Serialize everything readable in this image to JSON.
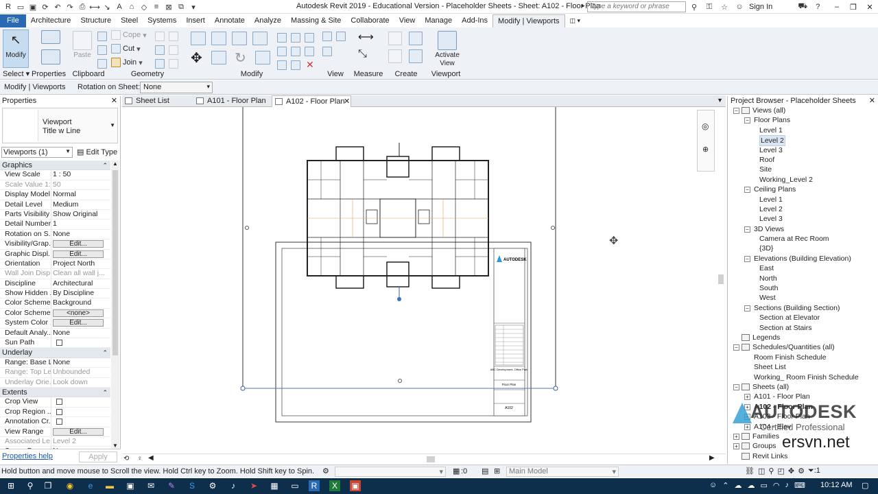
{
  "window": {
    "title": "Autodesk Revit 2019 - Educational Version - Placeholder Sheets - Sheet: A102 - Floor Plan",
    "search_placeholder": "Type a keyword or phrase",
    "sign_in": "Sign In"
  },
  "ribbon_tabs": [
    "File",
    "Architecture",
    "Structure",
    "Steel",
    "Systems",
    "Insert",
    "Annotate",
    "Analyze",
    "Massing & Site",
    "Collaborate",
    "View",
    "Manage",
    "Add-Ins",
    "Modify | Viewports"
  ],
  "ribbon": {
    "modify_label": "Modify",
    "select_label": "Select",
    "properties_label": "Properties",
    "clipboard_label": "Clipboard",
    "paste_label": "Paste",
    "cope_label": "Cope",
    "cut_label": "Cut",
    "join_label": "Join",
    "geometry_label": "Geometry",
    "modify_panel_label": "Modify",
    "view_label": "View",
    "measure_label": "Measure",
    "create_label": "Create",
    "activate_view_label": "Activate View",
    "viewport_label": "Viewport"
  },
  "options_bar": {
    "context": "Modify | Viewports",
    "rotation_label": "Rotation on Sheet:",
    "rotation_value": "None"
  },
  "properties": {
    "header": "Properties",
    "type_family": "Viewport",
    "type_name": "Title w Line",
    "filter": "Viewports (1)",
    "edit_type": "Edit Type",
    "sections": [
      {
        "name": "Graphics",
        "rows": [
          {
            "k": "View Scale",
            "v": "1 : 50"
          },
          {
            "k": "Scale Value    1:",
            "v": "50",
            "ro": true
          },
          {
            "k": "Display Model",
            "v": "Normal"
          },
          {
            "k": "Detail Level",
            "v": "Medium"
          },
          {
            "k": "Parts Visibility",
            "v": "Show Original"
          },
          {
            "k": "Detail Number",
            "v": "1"
          },
          {
            "k": "Rotation on S...",
            "v": "None"
          },
          {
            "k": "Visibility/Grap...",
            "v": "Edit...",
            "btn": true
          },
          {
            "k": "Graphic Displ...",
            "v": "Edit...",
            "btn": true
          },
          {
            "k": "Orientation",
            "v": "Project North"
          },
          {
            "k": "Wall Join Disp...",
            "v": "Clean all wall j...",
            "ro": true
          },
          {
            "k": "Discipline",
            "v": "Architectural"
          },
          {
            "k": "Show Hidden ...",
            "v": "By Discipline"
          },
          {
            "k": "Color Scheme...",
            "v": "Background"
          },
          {
            "k": "Color Scheme",
            "v": "<none>",
            "btn": true
          },
          {
            "k": "System Color ...",
            "v": "Edit...",
            "btn": true
          },
          {
            "k": "Default Analy...",
            "v": "None"
          },
          {
            "k": "Sun Path",
            "v": "",
            "cb": true
          }
        ]
      },
      {
        "name": "Underlay",
        "rows": [
          {
            "k": "Range: Base L...",
            "v": "None"
          },
          {
            "k": "Range: Top Le...",
            "v": "Unbounded",
            "ro": true
          },
          {
            "k": "Underlay Orie...",
            "v": "Look down",
            "ro": true
          }
        ]
      },
      {
        "name": "Extents",
        "rows": [
          {
            "k": "Crop View",
            "v": "",
            "cb": true
          },
          {
            "k": "Crop Region ...",
            "v": "",
            "cb": true
          },
          {
            "k": "Annotation Cr...",
            "v": "",
            "cb": true
          },
          {
            "k": "View Range",
            "v": "Edit...",
            "btn": true
          },
          {
            "k": "Associated Le...",
            "v": "Level 2",
            "ro": true
          },
          {
            "k": "Scope Box",
            "v": "None"
          }
        ]
      }
    ],
    "help_link": "Properties help",
    "apply": "Apply"
  },
  "view_tabs": [
    {
      "label": "Sheet List",
      "active": false
    },
    {
      "label": "A101 - Floor Plan",
      "active": false
    },
    {
      "label": "A102 - Floor Plan",
      "active": true
    }
  ],
  "titleblock": {
    "brand": "AUTODESK",
    "project": "ABC Development, Office Park",
    "sheet_name": "Floor Plan",
    "sheet_number": "A102"
  },
  "project_browser": {
    "header": "Project Browser - Placeholder Sheets",
    "items": [
      {
        "label": "Views (all)",
        "lvl": 0,
        "tg": "-",
        "icon": true
      },
      {
        "label": "Floor Plans",
        "lvl": 1,
        "tg": "-"
      },
      {
        "label": "Level 1",
        "lvl": 2
      },
      {
        "label": "Level 2",
        "lvl": 2,
        "sel": true
      },
      {
        "label": "Level 3",
        "lvl": 2
      },
      {
        "label": "Roof",
        "lvl": 2
      },
      {
        "label": "Site",
        "lvl": 2
      },
      {
        "label": "Working_Level 2",
        "lvl": 2
      },
      {
        "label": "Ceiling Plans",
        "lvl": 1,
        "tg": "-"
      },
      {
        "label": "Level 1",
        "lvl": 2
      },
      {
        "label": "Level 2",
        "lvl": 2
      },
      {
        "label": "Level 3",
        "lvl": 2
      },
      {
        "label": "3D Views",
        "lvl": 1,
        "tg": "-"
      },
      {
        "label": "Camera at Rec Room",
        "lvl": 2
      },
      {
        "label": "{3D}",
        "lvl": 2
      },
      {
        "label": "Elevations (Building Elevation)",
        "lvl": 1,
        "tg": "-"
      },
      {
        "label": "East",
        "lvl": 2
      },
      {
        "label": "North",
        "lvl": 2
      },
      {
        "label": "South",
        "lvl": 2
      },
      {
        "label": "West",
        "lvl": 2
      },
      {
        "label": "Sections (Building Section)",
        "lvl": 1,
        "tg": "-"
      },
      {
        "label": "Section at Elevator",
        "lvl": 2
      },
      {
        "label": "Section at Stairs",
        "lvl": 2
      },
      {
        "label": "Legends",
        "lvl": 0,
        "icon": true
      },
      {
        "label": "Schedules/Quantities (all)",
        "lvl": 0,
        "tg": "-",
        "icon": true
      },
      {
        "label": "Room Finish Schedule",
        "lvl": 1
      },
      {
        "label": "Sheet List",
        "lvl": 1
      },
      {
        "label": "Working_ Room Finish Schedule",
        "lvl": 1
      },
      {
        "label": "Sheets (all)",
        "lvl": 0,
        "tg": "-",
        "icon": true
      },
      {
        "label": "A101 - Floor Plan",
        "lvl": 1,
        "tg": "+"
      },
      {
        "label": "A102 - Floor Plan",
        "lvl": 1,
        "tg": "+",
        "bold": true
      },
      {
        "label": "A103 - Floor Plan",
        "lvl": 1,
        "tg": "+"
      },
      {
        "label": "A104 - Elev",
        "lvl": 1,
        "tg": "+"
      },
      {
        "label": "Families",
        "lvl": 0,
        "tg": "+",
        "icon": true
      },
      {
        "label": "Groups",
        "lvl": 0,
        "tg": "+",
        "icon": true
      },
      {
        "label": "Revit Links",
        "lvl": 0,
        "icon": true
      }
    ]
  },
  "watermark": {
    "brand": "AUTODESK",
    "cert": "Certified Professional",
    "site": "ersvn.net"
  },
  "status": {
    "message": "Hold button and move mouse to Scroll the view. Hold Ctrl key to Zoom. Hold Shift key to Spin.",
    "zero": ":0",
    "model": "Main Model"
  },
  "taskbar": {
    "time": "10:12 AM"
  }
}
